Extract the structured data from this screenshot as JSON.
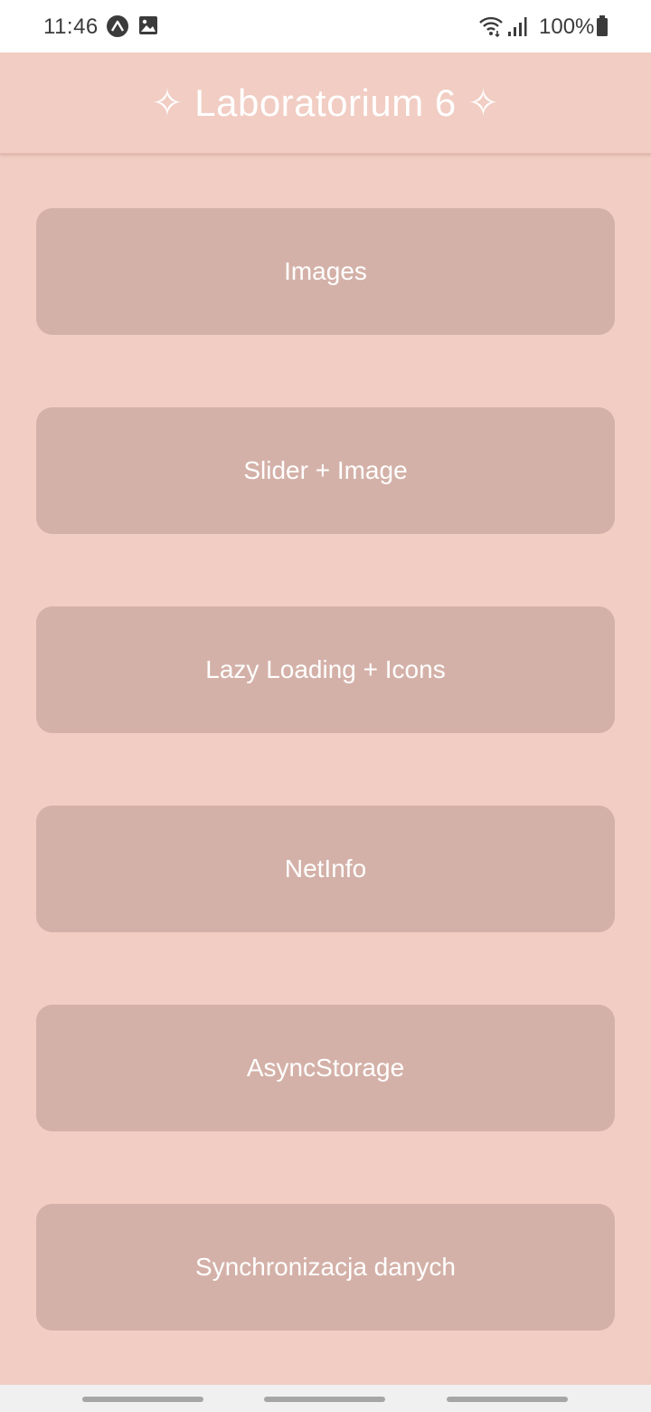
{
  "status_bar": {
    "time": "11:46",
    "battery": "100%",
    "icons": [
      "expo-icon",
      "image-icon",
      "wifi-icon",
      "signal-icon",
      "battery-icon"
    ]
  },
  "header": {
    "title": "✧ Laboratorium 6 ✧"
  },
  "menu": {
    "items": [
      {
        "label": "Images"
      },
      {
        "label": "Slider + Image"
      },
      {
        "label": "Lazy Loading + Icons"
      },
      {
        "label": "NetInfo"
      },
      {
        "label": "AsyncStorage"
      },
      {
        "label": "Synchronizacja danych"
      }
    ]
  },
  "colors": {
    "background": "#f1cdc3",
    "button": "#d4b1a8",
    "text": "#ffffff"
  }
}
